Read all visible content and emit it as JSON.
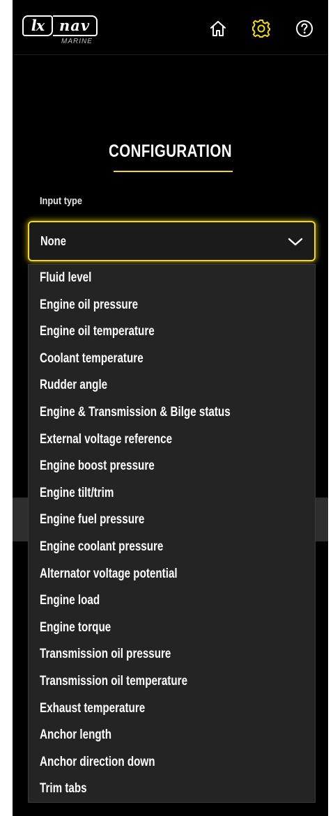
{
  "header": {
    "logo_lx": "lx",
    "logo_nav": "nav",
    "logo_sub": "MARINE",
    "icons": [
      "home-icon",
      "gear-icon",
      "help-icon"
    ],
    "active_icon": "gear-icon"
  },
  "page": {
    "title": "CONFIGURATION"
  },
  "input_type": {
    "label": "Input type",
    "selected": "None",
    "options": [
      "Fluid level",
      "Engine oil pressure",
      "Engine oil temperature",
      "Coolant temperature",
      "Rudder angle",
      "Engine & Transmission & Bilge status",
      "External voltage reference",
      "Engine boost pressure",
      "Engine tilt/trim",
      "Engine fuel pressure",
      "Engine coolant pressure",
      "Alternator voltage potential",
      "Engine load",
      "Engine torque",
      "Transmission oil pressure",
      "Transmission oil temperature",
      "Exhaust temperature",
      "Anchor length",
      "Anchor direction down",
      "Trim tabs"
    ]
  },
  "colors": {
    "accent": "#f3d916",
    "background": "#000000",
    "dropdown_bg": "#242424",
    "text": "#ffffff"
  }
}
